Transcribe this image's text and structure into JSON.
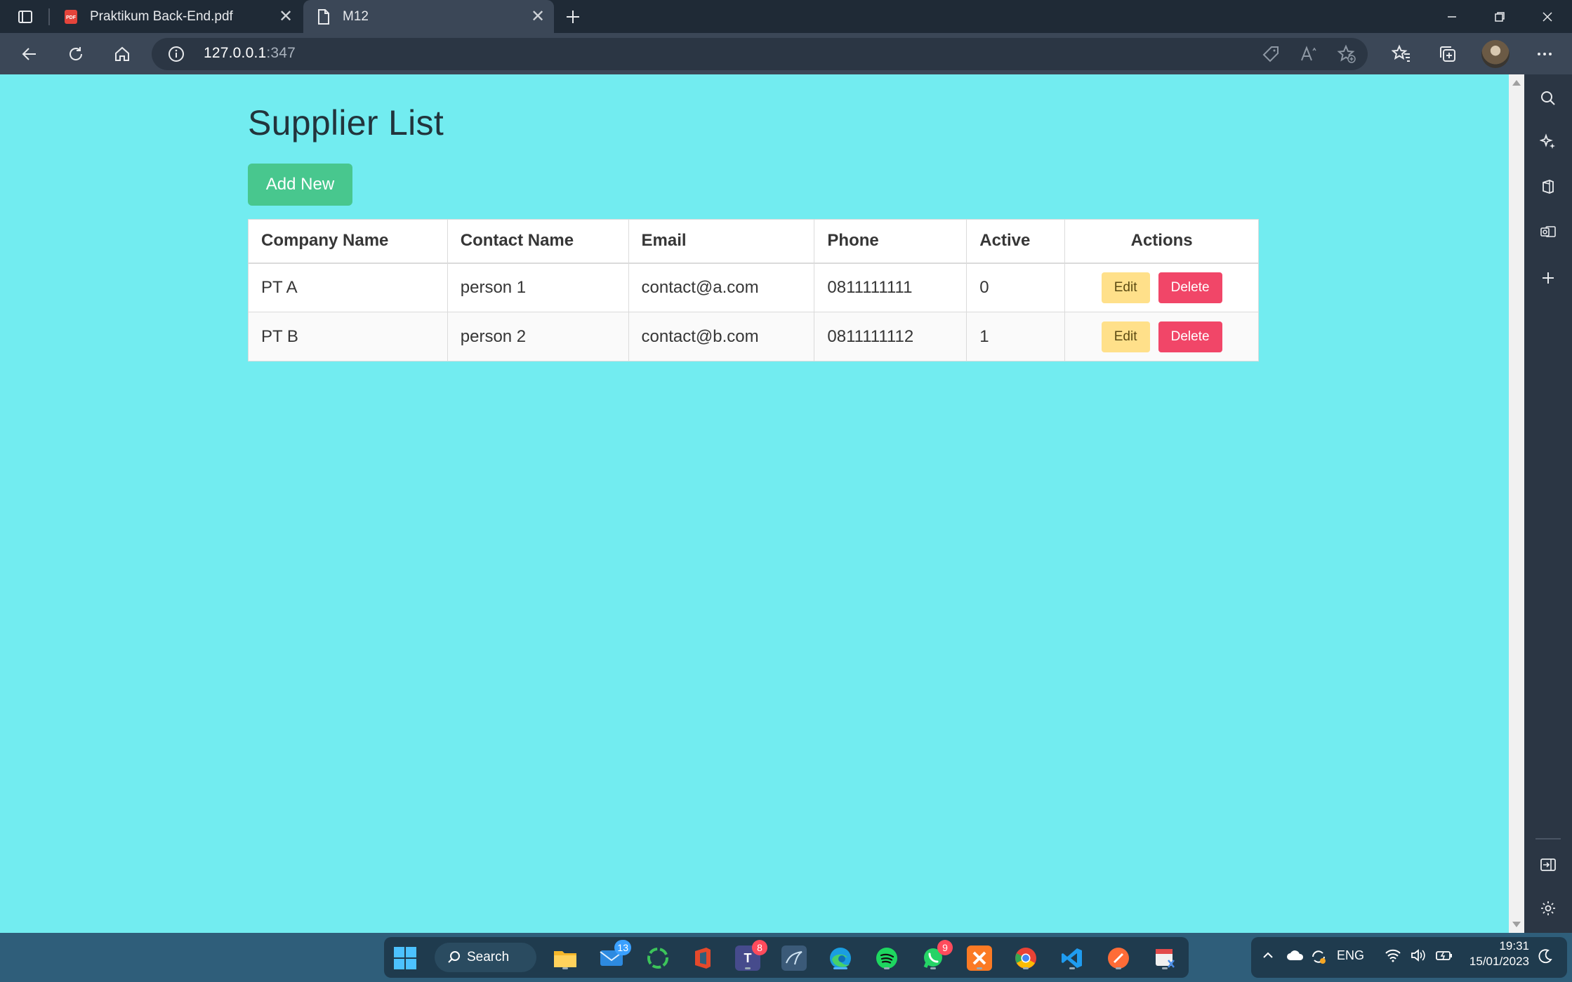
{
  "browser": {
    "tabs": [
      {
        "title": "Praktikum Back-End.pdf",
        "icon": "pdf-icon"
      },
      {
        "title": "M12",
        "icon": "page-icon"
      }
    ],
    "url_host": "127.0.0.1",
    "url_port": ":347"
  },
  "page": {
    "title": "Supplier List",
    "add_button": "Add New",
    "table": {
      "headers": [
        "Company Name",
        "Contact Name",
        "Email",
        "Phone",
        "Active",
        "Actions"
      ],
      "rows": [
        {
          "company": "PT A",
          "contact": "person 1",
          "email": "contact@a.com",
          "phone": "0811111111",
          "active": "0"
        },
        {
          "company": "PT B",
          "contact": "person 2",
          "email": "contact@b.com",
          "phone": "0811111112",
          "active": "1"
        }
      ],
      "edit_label": "Edit",
      "delete_label": "Delete"
    }
  },
  "taskbar": {
    "search_label": "Search",
    "badges": {
      "mail": "13",
      "teams": "8",
      "whatsapp": "9"
    },
    "language": "ENG",
    "time": "19:31",
    "date": "15/01/2023"
  },
  "colors": {
    "page_background": "#72ecf0",
    "add_button": "#48c78e",
    "edit_button": "#ffe08a",
    "delete_button": "#f14668"
  }
}
